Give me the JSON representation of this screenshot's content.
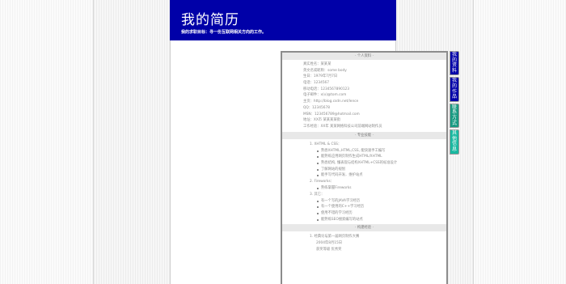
{
  "header": {
    "title": "我的简历",
    "subtitle": "我的求职目标：寻一份互联网相关方向的工作。"
  },
  "tabs": [
    {
      "label": "我的资料",
      "color": "#0000a8"
    },
    {
      "label": "我的作品",
      "color": "#0000a8"
    },
    {
      "label": "联系方式",
      "color": "#1a9a82"
    },
    {
      "label": "其他信息",
      "color": "#19b8a0"
    }
  ],
  "sections": {
    "personal": "· 个人资料 ·",
    "skills": "· 专业技能 ·",
    "experience": "· 构建经验 ·"
  },
  "personal_info": [
    "真实姓名：某某某",
    "英文名或昵称：some body",
    "生日：1979年7月7日",
    "电话：1234567",
    "移动电话：1234567890123",
    "电子邮件：x(x)@tom.com",
    "主页：http://blog.csdn.net/lence",
    "QQ：12345678",
    "MSN：123456789@hotmail.com",
    "地址：XX市 某某某某街",
    "工作经验：XX年 某某网络科技公司前端网站制作员"
  ],
  "skills": [
    {
      "title": "1. XHTML & CSS：",
      "items": [
        "熟悉XHTML,HTML,CSS, 能快速手工编写",
        "能熟练应用网页制作生成HTML/XHTML",
        "熟悉结构, 懂表现与结构XHTML+CSS的标准设计",
        "了解网站的规划",
        "能手写代码开发、维护站点"
      ]
    },
    {
      "title": "2. Fireworks：",
      "items": [
        "熟练掌握Fireworks"
      ]
    },
    {
      "title": "3. 其它：",
      "items": [
        "有一个写的JAVA学习经历",
        "有一个使用的C++学习经历",
        "使用不错的学习经历",
        "能熟练SEO搜索编写的站点"
      ]
    }
  ],
  "experience": [
    {
      "title": "1. 经典论坛第一届网页制作大赛"
    },
    {
      "line": "2004年8月15日"
    },
    {
      "line": "获奖等级 优秀奖"
    }
  ]
}
